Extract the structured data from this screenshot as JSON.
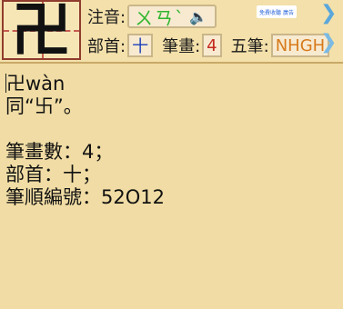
{
  "header": {
    "character": "卍",
    "zhuyin_label": "注音:",
    "zhuyin_value": "ㄨㄢˋ",
    "radical_label": "部首:",
    "radical_value": "十",
    "strokes_label": "筆畫:",
    "strokes_value": "4",
    "wubi_label": "五筆:",
    "wubi_value": "NHGH",
    "chip_text": "免費收聽 廣告"
  },
  "icons": {
    "speaker": "speaker-icon",
    "next": "chevron-right-icon"
  },
  "definition": {
    "entry": "卍wàn",
    "variant": "同“卐”。",
    "stroke_count": "筆畫數：4；",
    "radical": "部首：十；",
    "stroke_order": "筆順編號：52O12"
  },
  "colors": {
    "background": "#f0dca4",
    "zhuyin": "#2fb52d",
    "radical": "#1b3fb8",
    "strokes": "#c4291e",
    "wubi": "#d77a1c",
    "chevron": "#5aa7dc"
  }
}
